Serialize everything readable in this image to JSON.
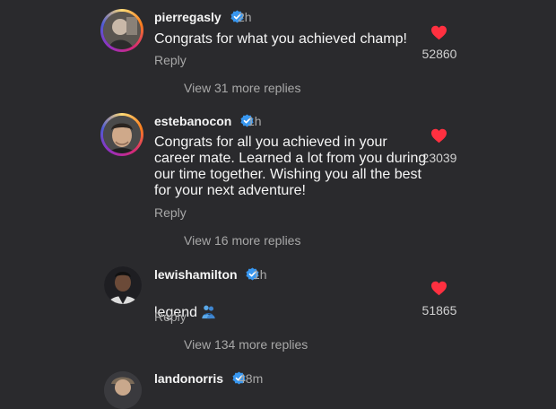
{
  "comments": [
    {
      "username": "pierregasly",
      "time": "2h",
      "text": "Congrats for what you achieved champ!",
      "reply_label": "Reply",
      "likes": "52860",
      "view_more": "View 31 more replies"
    },
    {
      "username": "estebanocon",
      "time": "1h",
      "text": "Congrats for all you achieved in your\ncareer mate. Learned a lot from you during\nour time together. Wishing you all the best\nfor your next adventure!",
      "reply_label": "Reply",
      "likes": "23039",
      "view_more": "View 16 more replies"
    },
    {
      "username": "lewishamilton",
      "time": "1h",
      "text": "legend",
      "emoji": "person-hugging-emoji",
      "reply_label": "Reply",
      "likes": "51865",
      "view_more": "View 134 more replies"
    },
    {
      "username": "landonorris",
      "time": "48m"
    }
  ],
  "colors": {
    "background": "#2a2a2d",
    "like_heart": "#ff3040",
    "verified_badge": "#3897f0",
    "secondary_text": "#a8a8a8"
  }
}
